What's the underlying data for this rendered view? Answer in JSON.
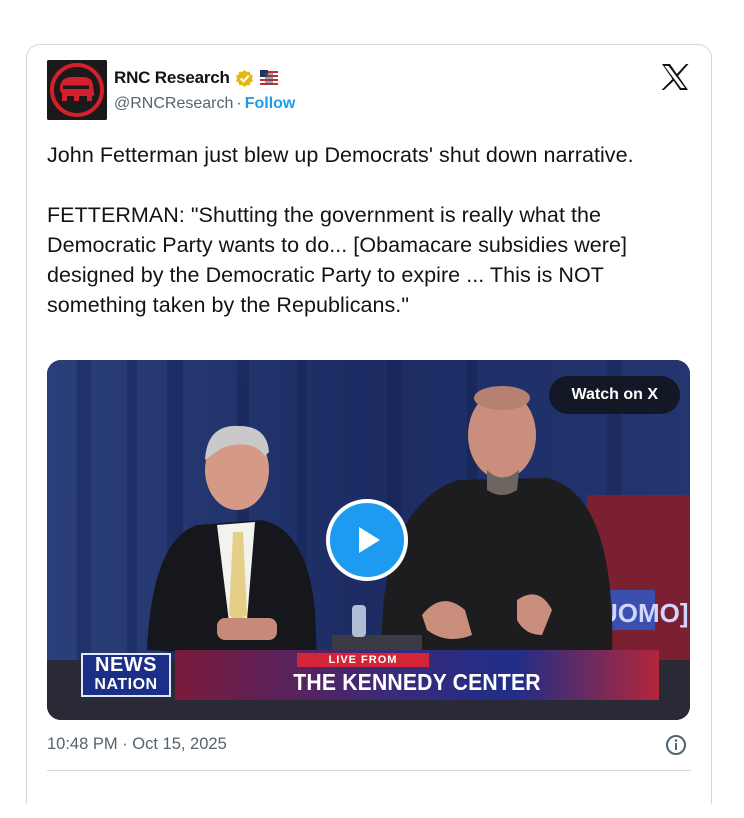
{
  "author": {
    "display_name": "RNC Research",
    "handle": "@RNCResearch",
    "separator": "·",
    "follow_label": "Follow",
    "verified_badge": "gold-verified-badge",
    "affiliate_badge": "affiliate-flag-badge",
    "avatar_icon": "republican-elephant-logo"
  },
  "platform_icon": "x-logo-icon",
  "tweet": {
    "text": "John Fetterman just blew up Democrats' shut down narrative.\n\nFETTERMAN: \"Shutting the government is really what the Democratic Party wants to do... [Obamacare subsidies were] designed by the Democratic Party to expire ... This is NOT something taken by the Republicans.\""
  },
  "video": {
    "watch_label": "Watch on X",
    "play_icon": "play-icon",
    "network_logo_line1": "NEWS",
    "network_logo_line2": "NATION",
    "live_tag": "LIVE FROM",
    "banner_text": "THE KENNEDY CENTER",
    "backdrop_text": "UOMO]"
  },
  "footer": {
    "timestamp": "10:48 PM · Oct 15, 2025",
    "info_icon": "info-icon"
  },
  "colors": {
    "accent": "#1d9bf0",
    "text": "#0f1419",
    "muted": "#536471",
    "border": "#cfd9de",
    "verified_gold": "#e2b719"
  }
}
